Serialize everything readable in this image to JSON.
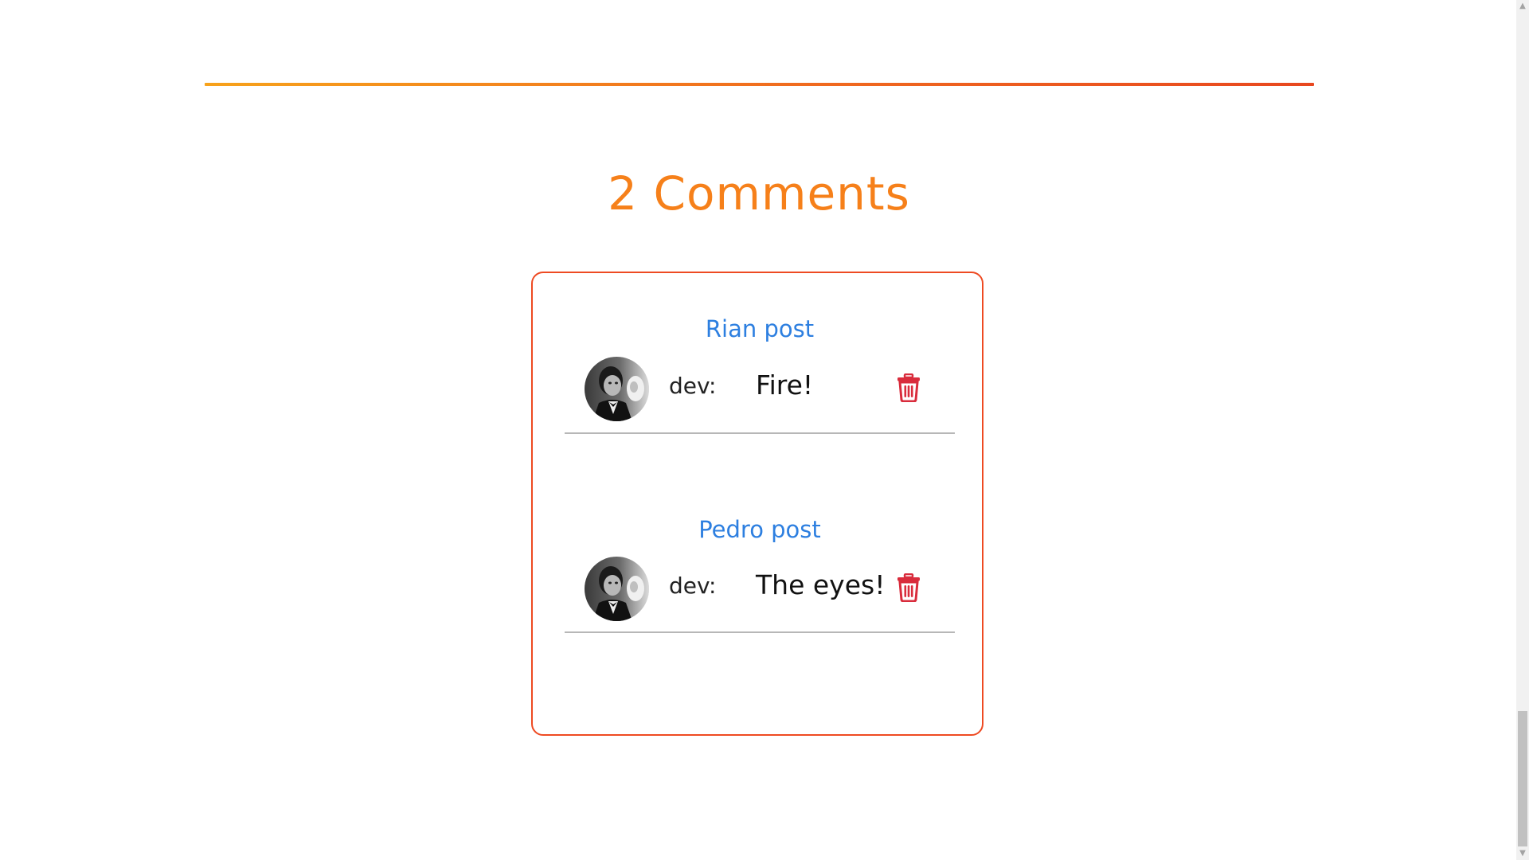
{
  "section": {
    "title": "2 Comments"
  },
  "comments": [
    {
      "post_title": "Rian post",
      "username": "dev:",
      "text": "Fire!",
      "avatar_icon": "user-avatar-photo",
      "delete_icon": "trash-icon"
    },
    {
      "post_title": "Pedro post",
      "username": "dev:",
      "text": "The eyes!",
      "avatar_icon": "user-avatar-photo",
      "delete_icon": "trash-icon"
    }
  ],
  "colors": {
    "accent": "#f6801a",
    "card_border": "#ee4a22",
    "link": "#2d7fe0",
    "delete": "#d92c3c",
    "divider_start": "#f7a21b",
    "divider_end": "#e8471f"
  }
}
